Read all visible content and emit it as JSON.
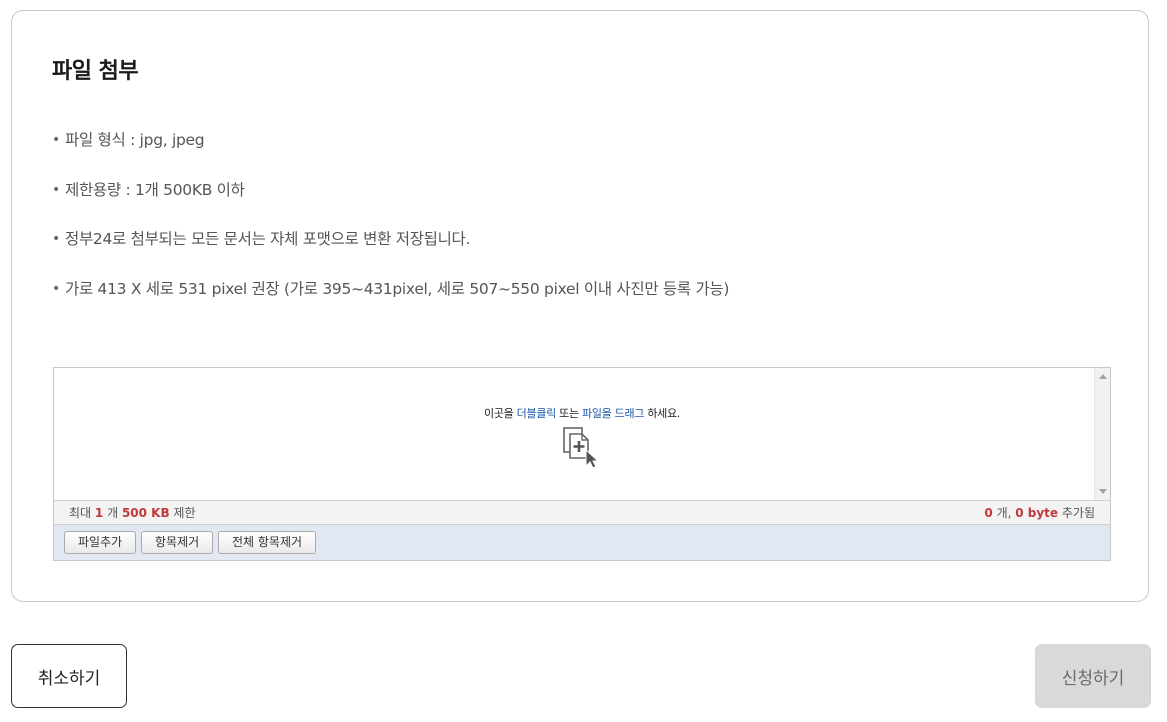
{
  "section": {
    "title": "파일 첨부",
    "notes": [
      "파일 형식 : jpg, jpeg",
      "제한용량 : 1개 500KB 이하",
      "정부24로 첨부되는 모든 문서는 자체 포맷으로 변환 저장됩니다.",
      "가로 413 X 세로 531 pixel 권장 (가로 395~431pixel, 세로 507~550 pixel 이내 사진만 등록 가능)"
    ]
  },
  "uploader": {
    "drop_prefix": "이곳을 ",
    "drop_link1": "더블클릭",
    "drop_mid": " 또는 ",
    "drop_link2": "파일을 드래그",
    "drop_suffix": " 하세요.",
    "drop_icon": "file-add-cursor-icon",
    "limit_prefix": "최대 ",
    "limit_count": "1",
    "limit_count_unit": " 개 ",
    "limit_size": "500 KB",
    "limit_suffix": " 제한",
    "added_count": "0",
    "added_count_unit": " 개, ",
    "added_size": "0 byte",
    "added_suffix": " 추가됨",
    "buttons": {
      "add": "파일추가",
      "remove": "항목제거",
      "remove_all": "전체 항목제거"
    }
  },
  "footer": {
    "cancel_label": "취소하기",
    "submit_label": "신청하기"
  },
  "colors": {
    "highlight_link": "#1a57a6",
    "limit_emphasis": "#c0393b",
    "action_bar": "#e1e8f1",
    "submit_disabled_bg": "#d9d9d9"
  }
}
